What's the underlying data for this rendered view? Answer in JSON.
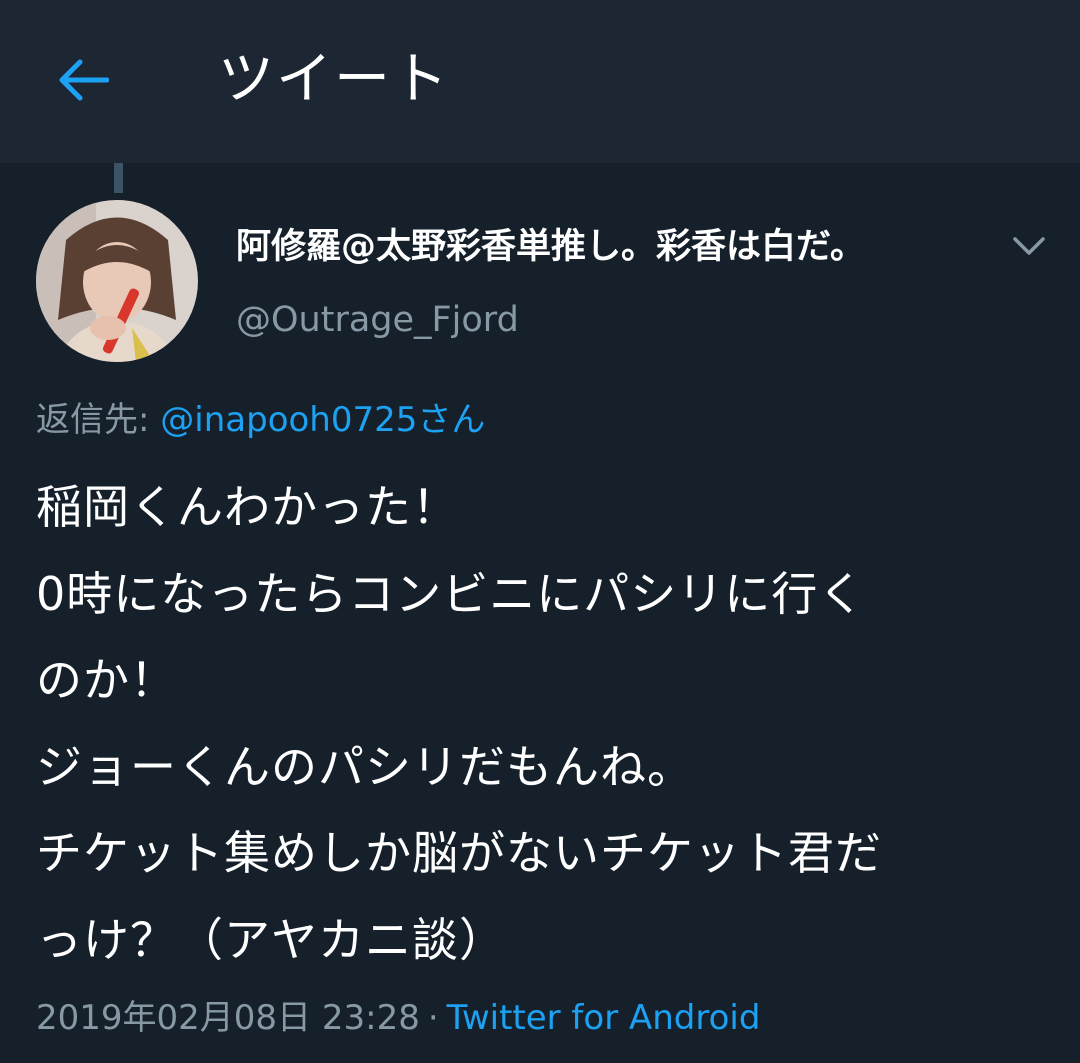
{
  "header": {
    "title": "ツイート",
    "back_icon": "arrow-left-icon",
    "accent_color": "#1da1f2",
    "background_color": "#1c2733"
  },
  "tweet": {
    "author": {
      "display_name": "阿修羅@太野彩香単推し。彩香は白だ。",
      "handle": "@Outrage_Fjord",
      "avatar_icon": "user-avatar"
    },
    "menu_icon": "chevron-down-icon",
    "reply_label": "返信先:",
    "reply_to": "@inapooh0725さん",
    "lines": [
      "稲岡くんわかった！",
      "0時になったらコンビニにパシリに行く",
      "のか！",
      "ジョーくんのパシリだもんね。",
      "チケット集めしか脳がないチケット君だ",
      "っけ？（アヤカニ談）"
    ],
    "timestamp": "2019年02月08日 23:28",
    "separator": "·",
    "source": "Twitter for Android"
  },
  "colors": {
    "background": "#15202b",
    "text_primary": "#ffffff",
    "text_secondary": "#8899a6",
    "link": "#1da1f2"
  }
}
